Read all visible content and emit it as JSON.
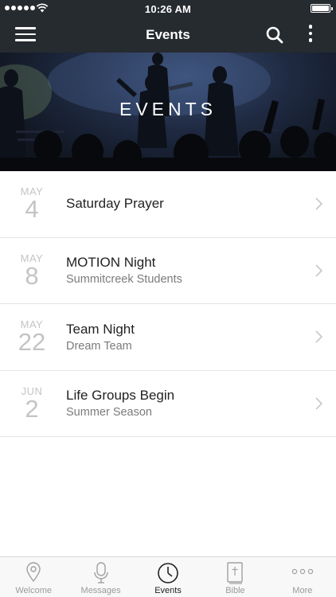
{
  "status_bar": {
    "time": "10:26 AM"
  },
  "nav": {
    "title": "Events"
  },
  "hero": {
    "title": "EVENTS"
  },
  "events": [
    {
      "month": "MAY",
      "day": "4",
      "title": "Saturday Prayer",
      "subtitle": ""
    },
    {
      "month": "MAY",
      "day": "8",
      "title": "MOTION Night",
      "subtitle": "Summitcreek Students"
    },
    {
      "month": "MAY",
      "day": "22",
      "title": "Team Night",
      "subtitle": "Dream Team"
    },
    {
      "month": "JUN",
      "day": "2",
      "title": "Life Groups Begin",
      "subtitle": "Summer Season"
    }
  ],
  "tabs": [
    {
      "label": "Welcome",
      "icon": "location-pin-icon"
    },
    {
      "label": "Messages",
      "icon": "microphone-icon"
    },
    {
      "label": "Events",
      "icon": "clock-icon",
      "active": true
    },
    {
      "label": "Bible",
      "icon": "bible-icon"
    },
    {
      "label": "More",
      "icon": "more-dots-icon"
    }
  ],
  "colors": {
    "nav_background": "#262b30",
    "date_text": "#c4c4c4",
    "subtitle_text": "#7b7b7b",
    "tab_inactive": "#9a9a9a",
    "tab_active": "#222222"
  }
}
